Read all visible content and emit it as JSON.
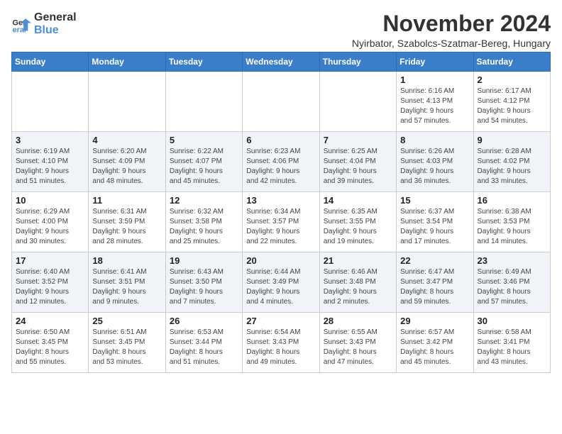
{
  "logo": {
    "general": "General",
    "blue": "Blue"
  },
  "title": "November 2024",
  "location": "Nyirbator, Szabolcs-Szatmar-Bereg, Hungary",
  "weekdays": [
    "Sunday",
    "Monday",
    "Tuesday",
    "Wednesday",
    "Thursday",
    "Friday",
    "Saturday"
  ],
  "weeks": [
    [
      {
        "day": "",
        "info": ""
      },
      {
        "day": "",
        "info": ""
      },
      {
        "day": "",
        "info": ""
      },
      {
        "day": "",
        "info": ""
      },
      {
        "day": "",
        "info": ""
      },
      {
        "day": "1",
        "info": "Sunrise: 6:16 AM\nSunset: 4:13 PM\nDaylight: 9 hours\nand 57 minutes."
      },
      {
        "day": "2",
        "info": "Sunrise: 6:17 AM\nSunset: 4:12 PM\nDaylight: 9 hours\nand 54 minutes."
      }
    ],
    [
      {
        "day": "3",
        "info": "Sunrise: 6:19 AM\nSunset: 4:10 PM\nDaylight: 9 hours\nand 51 minutes."
      },
      {
        "day": "4",
        "info": "Sunrise: 6:20 AM\nSunset: 4:09 PM\nDaylight: 9 hours\nand 48 minutes."
      },
      {
        "day": "5",
        "info": "Sunrise: 6:22 AM\nSunset: 4:07 PM\nDaylight: 9 hours\nand 45 minutes."
      },
      {
        "day": "6",
        "info": "Sunrise: 6:23 AM\nSunset: 4:06 PM\nDaylight: 9 hours\nand 42 minutes."
      },
      {
        "day": "7",
        "info": "Sunrise: 6:25 AM\nSunset: 4:04 PM\nDaylight: 9 hours\nand 39 minutes."
      },
      {
        "day": "8",
        "info": "Sunrise: 6:26 AM\nSunset: 4:03 PM\nDaylight: 9 hours\nand 36 minutes."
      },
      {
        "day": "9",
        "info": "Sunrise: 6:28 AM\nSunset: 4:02 PM\nDaylight: 9 hours\nand 33 minutes."
      }
    ],
    [
      {
        "day": "10",
        "info": "Sunrise: 6:29 AM\nSunset: 4:00 PM\nDaylight: 9 hours\nand 30 minutes."
      },
      {
        "day": "11",
        "info": "Sunrise: 6:31 AM\nSunset: 3:59 PM\nDaylight: 9 hours\nand 28 minutes."
      },
      {
        "day": "12",
        "info": "Sunrise: 6:32 AM\nSunset: 3:58 PM\nDaylight: 9 hours\nand 25 minutes."
      },
      {
        "day": "13",
        "info": "Sunrise: 6:34 AM\nSunset: 3:57 PM\nDaylight: 9 hours\nand 22 minutes."
      },
      {
        "day": "14",
        "info": "Sunrise: 6:35 AM\nSunset: 3:55 PM\nDaylight: 9 hours\nand 19 minutes."
      },
      {
        "day": "15",
        "info": "Sunrise: 6:37 AM\nSunset: 3:54 PM\nDaylight: 9 hours\nand 17 minutes."
      },
      {
        "day": "16",
        "info": "Sunrise: 6:38 AM\nSunset: 3:53 PM\nDaylight: 9 hours\nand 14 minutes."
      }
    ],
    [
      {
        "day": "17",
        "info": "Sunrise: 6:40 AM\nSunset: 3:52 PM\nDaylight: 9 hours\nand 12 minutes."
      },
      {
        "day": "18",
        "info": "Sunrise: 6:41 AM\nSunset: 3:51 PM\nDaylight: 9 hours\nand 9 minutes."
      },
      {
        "day": "19",
        "info": "Sunrise: 6:43 AM\nSunset: 3:50 PM\nDaylight: 9 hours\nand 7 minutes."
      },
      {
        "day": "20",
        "info": "Sunrise: 6:44 AM\nSunset: 3:49 PM\nDaylight: 9 hours\nand 4 minutes."
      },
      {
        "day": "21",
        "info": "Sunrise: 6:46 AM\nSunset: 3:48 PM\nDaylight: 9 hours\nand 2 minutes."
      },
      {
        "day": "22",
        "info": "Sunrise: 6:47 AM\nSunset: 3:47 PM\nDaylight: 8 hours\nand 59 minutes."
      },
      {
        "day": "23",
        "info": "Sunrise: 6:49 AM\nSunset: 3:46 PM\nDaylight: 8 hours\nand 57 minutes."
      }
    ],
    [
      {
        "day": "24",
        "info": "Sunrise: 6:50 AM\nSunset: 3:45 PM\nDaylight: 8 hours\nand 55 minutes."
      },
      {
        "day": "25",
        "info": "Sunrise: 6:51 AM\nSunset: 3:45 PM\nDaylight: 8 hours\nand 53 minutes."
      },
      {
        "day": "26",
        "info": "Sunrise: 6:53 AM\nSunset: 3:44 PM\nDaylight: 8 hours\nand 51 minutes."
      },
      {
        "day": "27",
        "info": "Sunrise: 6:54 AM\nSunset: 3:43 PM\nDaylight: 8 hours\nand 49 minutes."
      },
      {
        "day": "28",
        "info": "Sunrise: 6:55 AM\nSunset: 3:43 PM\nDaylight: 8 hours\nand 47 minutes."
      },
      {
        "day": "29",
        "info": "Sunrise: 6:57 AM\nSunset: 3:42 PM\nDaylight: 8 hours\nand 45 minutes."
      },
      {
        "day": "30",
        "info": "Sunrise: 6:58 AM\nSunset: 3:41 PM\nDaylight: 8 hours\nand 43 minutes."
      }
    ]
  ]
}
